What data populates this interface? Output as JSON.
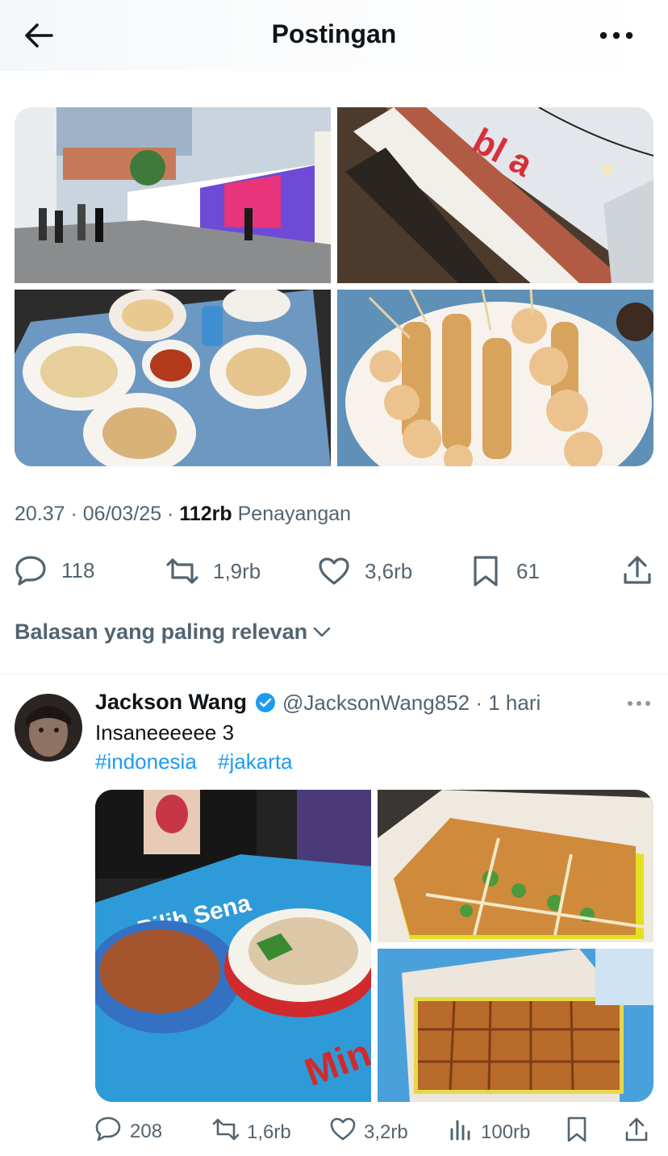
{
  "header": {
    "title": "Postingan"
  },
  "post": {
    "timestamp": "20.37 · 06/03/25 ·",
    "views_count": "112rb",
    "views_label": "Penayangan",
    "stats": {
      "replies": "118",
      "reposts": "1,9rb",
      "likes": "3,6rb",
      "bookmarks": "61"
    },
    "photos": [
      {
        "alt": "street mural alley"
      },
      {
        "alt": "building with red neon sign"
      },
      {
        "alt": "plates of food on blue table"
      },
      {
        "alt": "satay skewers with quail eggs"
      }
    ]
  },
  "sort_label": "Balasan yang paling relevan",
  "reply": {
    "name": "Jackson Wang",
    "handle": "@JacksonWang852",
    "time": "· 1 hari",
    "text": "Insaneeeeee 3",
    "hashtags": [
      "#indonesia",
      "#jakarta"
    ],
    "photos": [
      {
        "alt": "noodles and soup on blue table"
      },
      {
        "alt": "martabak telur in box"
      },
      {
        "alt": "martabak manis in box"
      }
    ],
    "stats": {
      "replies": "208",
      "reposts": "1,6rb",
      "likes": "3,2rb",
      "views": "100rb"
    }
  },
  "colors": {
    "text_primary": "#0f1419",
    "text_secondary": "#536471",
    "accent": "#1d9bf0",
    "divider": "#eff3f4"
  }
}
